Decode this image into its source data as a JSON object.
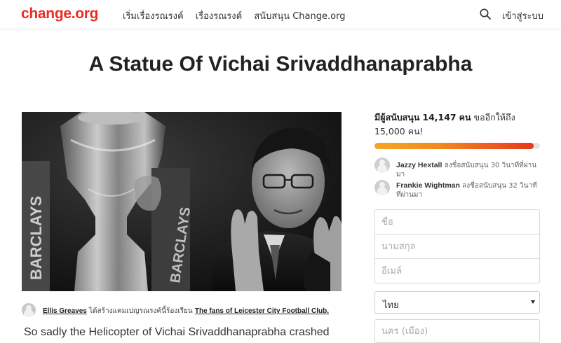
{
  "header": {
    "logo": "change.org",
    "nav": [
      "เริ่มเรื่องรณรงค์",
      "เรื่องรณรงค์",
      "สนับสนุน Change.org"
    ],
    "login": "เข้าสู่ระบบ",
    "search_icon": "search-icon"
  },
  "petition": {
    "title": "A Statue Of Vichai Srivaddhanaprabha",
    "image_alt": "Vichai Srivaddhanaprabha with the Premier League trophy",
    "starter": {
      "name": "Ellis Greaves",
      "middle": " ได้สร้างแคมเปญรณรงค์นี้ร้องเรียน ",
      "target": "The fans of Leicester City Football Club."
    },
    "body_first_line": "So sadly the Helicopter of Vichai Srivaddhanaprabha crashed"
  },
  "sidebar": {
    "count_prefix": "มีผู้สนับสนุน",
    "count": "14,147",
    "count_unit": "คน",
    "goal_text": "ขออีกให้ถึง 15,000 คน!",
    "progress": 0.96,
    "signers": [
      {
        "name": "Jazzy Hextall",
        "action": "ลงชื่อสนับสนุน 30 วินาทีที่ผ่านมา"
      },
      {
        "name": "Frankie Wightman",
        "action": "ลงชื่อสนับสนุน 32 วินาทีที่ผ่านมา"
      }
    ],
    "form": {
      "first_name_placeholder": "ชื่อ",
      "last_name_placeholder": "นามสกุล",
      "email_placeholder": "อีเมล์",
      "country": "ไทย",
      "city_placeholder": "นคร (เมือง)"
    }
  },
  "colors": {
    "brand": "#ec2c22",
    "progress_start": "#f5a623",
    "progress_end": "#e8371f"
  }
}
